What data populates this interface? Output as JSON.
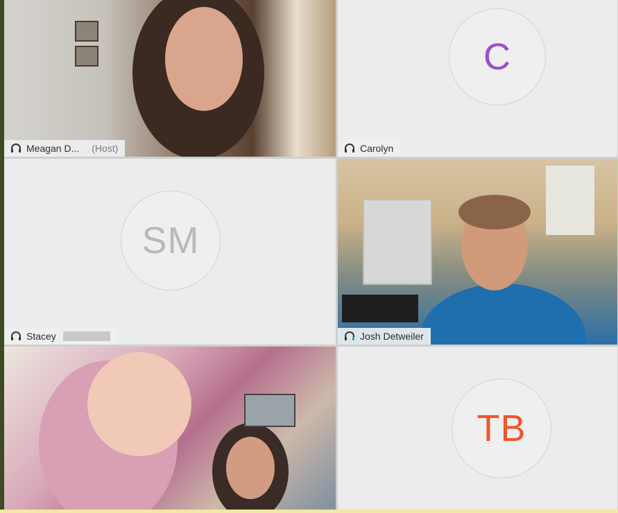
{
  "participants": [
    {
      "name": "Meagan D...",
      "role": "(Host)"
    },
    {
      "name": "Carolyn",
      "initials": "C",
      "initials_color": "#9b4fc9"
    },
    {
      "name": "Stacey",
      "initials": "SM",
      "initials_color": "#b9b9b9"
    },
    {
      "name": "Josh Detweiler",
      "active_speaker": true
    },
    {
      "initials": "TB",
      "initials_color": "#f0552b"
    }
  ],
  "colors": {
    "active_speaker_border": "#3bb4d8",
    "tile_background": "#ececec"
  }
}
